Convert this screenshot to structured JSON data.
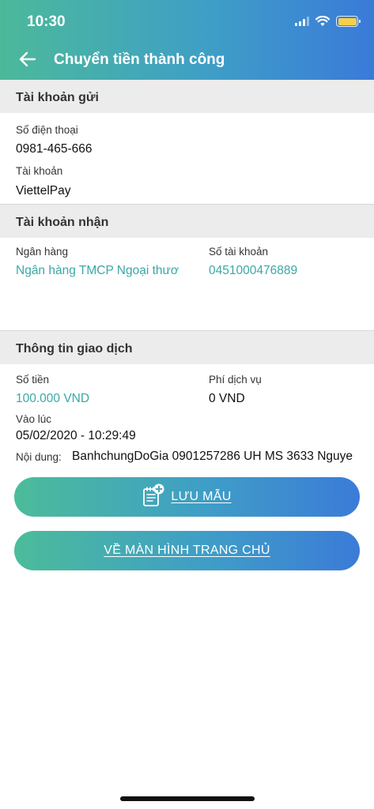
{
  "status_bar": {
    "time": "10:30"
  },
  "nav": {
    "title": "Chuyển tiền thành công"
  },
  "sender": {
    "section_title": "Tài khoản gửi",
    "phone_label": "Số điện thoại",
    "phone_value": "0981-465-666",
    "account_label": "Tài khoản",
    "account_value": "ViettelPay"
  },
  "receiver": {
    "section_title": "Tài khoản nhận",
    "bank_label": "Ngân hàng",
    "bank_value": "Ngân hàng TMCP Ngoại thươ",
    "account_no_label": "Số tài khoản",
    "account_no_value": "0451000476889"
  },
  "transaction": {
    "section_title": "Thông tin giao dịch",
    "amount_label": "Số tiền",
    "amount_value": "100.000 VND",
    "fee_label": "Phí dịch vụ",
    "fee_value": "0 VND",
    "time_label": "Vào lúc",
    "time_value": "05/02/2020 - 10:29:49",
    "content_label": "Nội dung:",
    "content_value": "BanhchungDoGia 0901257286 UH MS 3633 Nguye"
  },
  "buttons": {
    "save_template": "LƯU MẪU",
    "home": "VỀ MÀN HÌNH TRANG CHỦ"
  },
  "colors": {
    "accent_teal": "#3aa8a4",
    "gradient_start": "#4cb99a",
    "gradient_end": "#3a7ad9"
  }
}
